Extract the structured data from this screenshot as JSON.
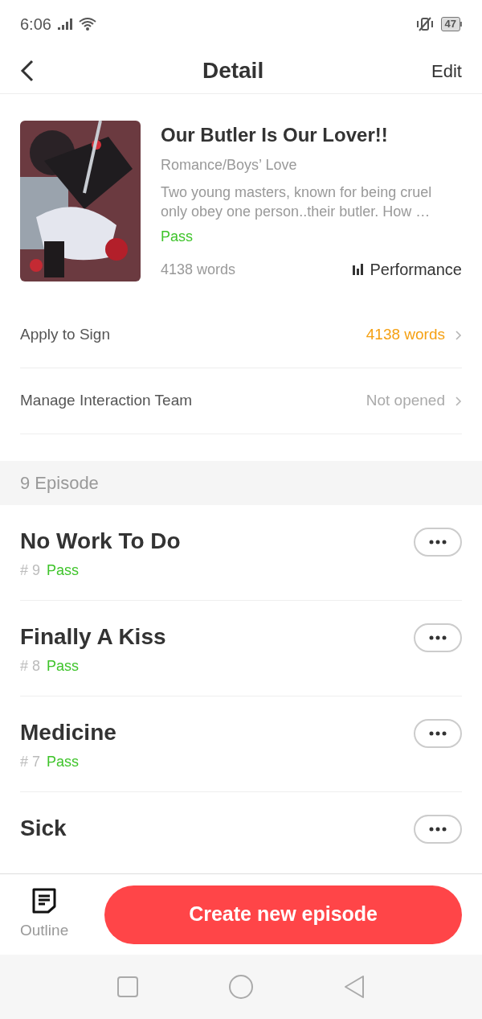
{
  "status_bar": {
    "time": "6:06",
    "battery": "47"
  },
  "header": {
    "title": "Detail",
    "action": "Edit"
  },
  "book": {
    "title": "Our Butler Is Our Lover!!",
    "genre": "Romance/Boys’ Love",
    "synopsis": "Two young masters, known for being cruel only obey one person..their butler. How …",
    "status": "Pass",
    "word_count": "4138 words",
    "performance": "Performance"
  },
  "settings": [
    {
      "label": "Apply to Sign",
      "value": "4138 words",
      "highlight": true
    },
    {
      "label": "Manage Interaction Team",
      "value": "Not opened",
      "highlight": false
    }
  ],
  "episodes_header": "9 Episode",
  "episodes": [
    {
      "title": "No Work To Do",
      "number": "# 9",
      "status": "Pass"
    },
    {
      "title": "Finally A Kiss",
      "number": "# 8",
      "status": "Pass"
    },
    {
      "title": "Medicine",
      "number": "# 7",
      "status": "Pass"
    },
    {
      "title": "Sick"
    }
  ],
  "bottom_bar": {
    "outline": "Outline",
    "create": "Create new episode"
  }
}
